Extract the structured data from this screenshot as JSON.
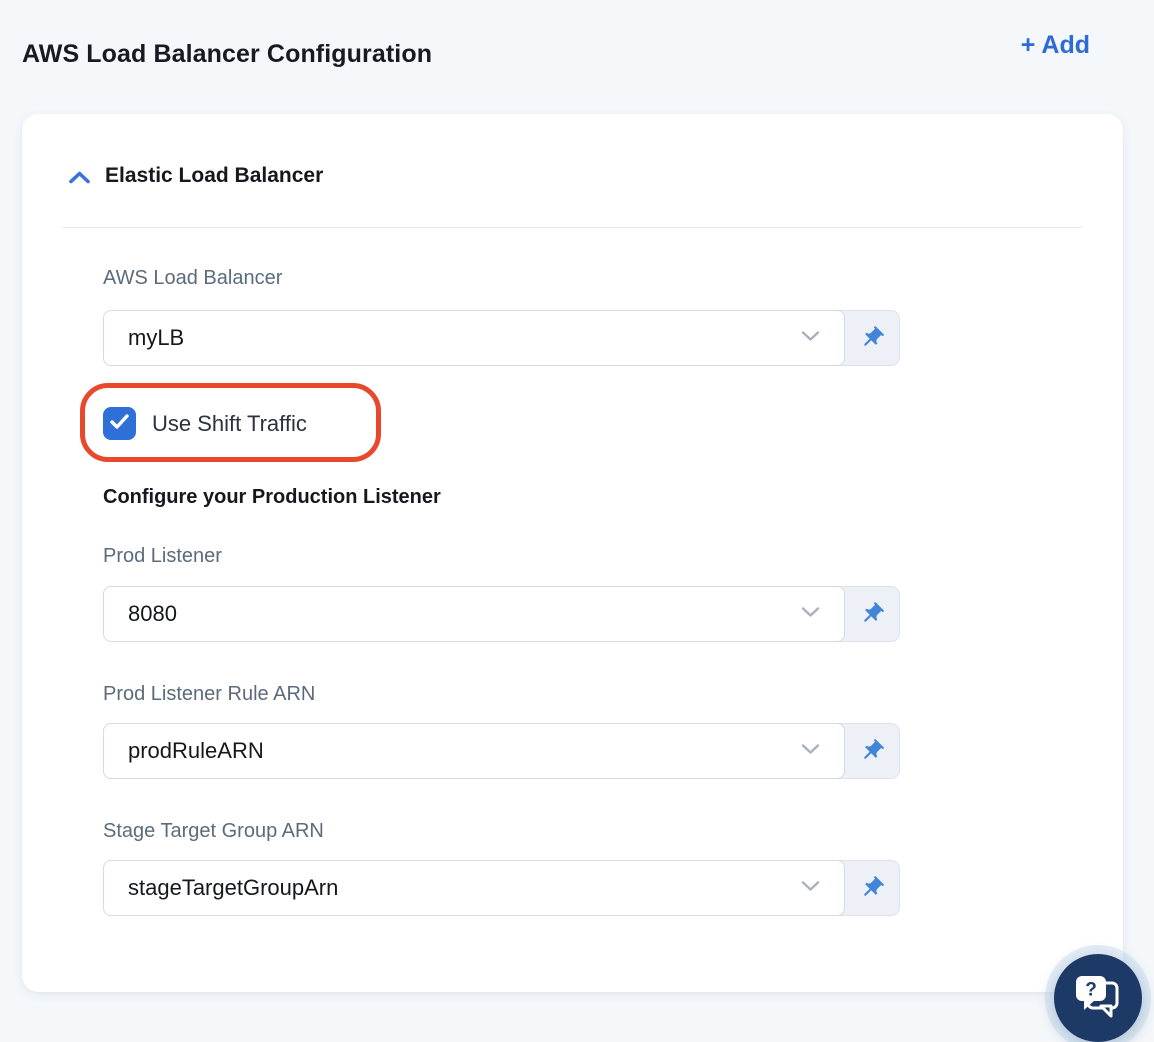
{
  "header": {
    "title": "AWS Load Balancer Configuration",
    "add_button_label": "+ Add"
  },
  "card": {
    "section": {
      "title": "Elastic Load Balancer",
      "collapsed": false,
      "collapse_icon": "chevron-up-icon"
    },
    "form": {
      "aws_lb": {
        "label": "AWS Load Balancer",
        "value": "myLB"
      },
      "shift_traffic": {
        "label": "Use Shift Traffic",
        "checked": true
      },
      "subheading": "Configure your Production Listener",
      "prod_listener": {
        "label": "Prod Listener",
        "value": "8080"
      },
      "prod_rule_arn": {
        "label": "Prod Listener Rule ARN",
        "value": "prodRuleARN"
      },
      "stage_tg_arn": {
        "label": "Stage Target Group ARN",
        "value": "stageTargetGroupArn"
      }
    }
  },
  "icons": {
    "field_dropdown": "chevron-down-icon",
    "field_pin": "pin-icon",
    "checkbox_check": "check-icon",
    "help_fab": "chat-question-icon"
  },
  "annotation": {
    "type": "highlight-oval",
    "target": "Use Shift Traffic checkbox",
    "color": "#e8492d"
  },
  "colors": {
    "page_bg": "#f4f8fb",
    "accent_blue": "#2e6bd6",
    "checkbox_blue": "#2e70d8",
    "pin_blue": "#4285d8",
    "annotation_red": "#e8492d",
    "chat_navy": "#1d3a66"
  }
}
